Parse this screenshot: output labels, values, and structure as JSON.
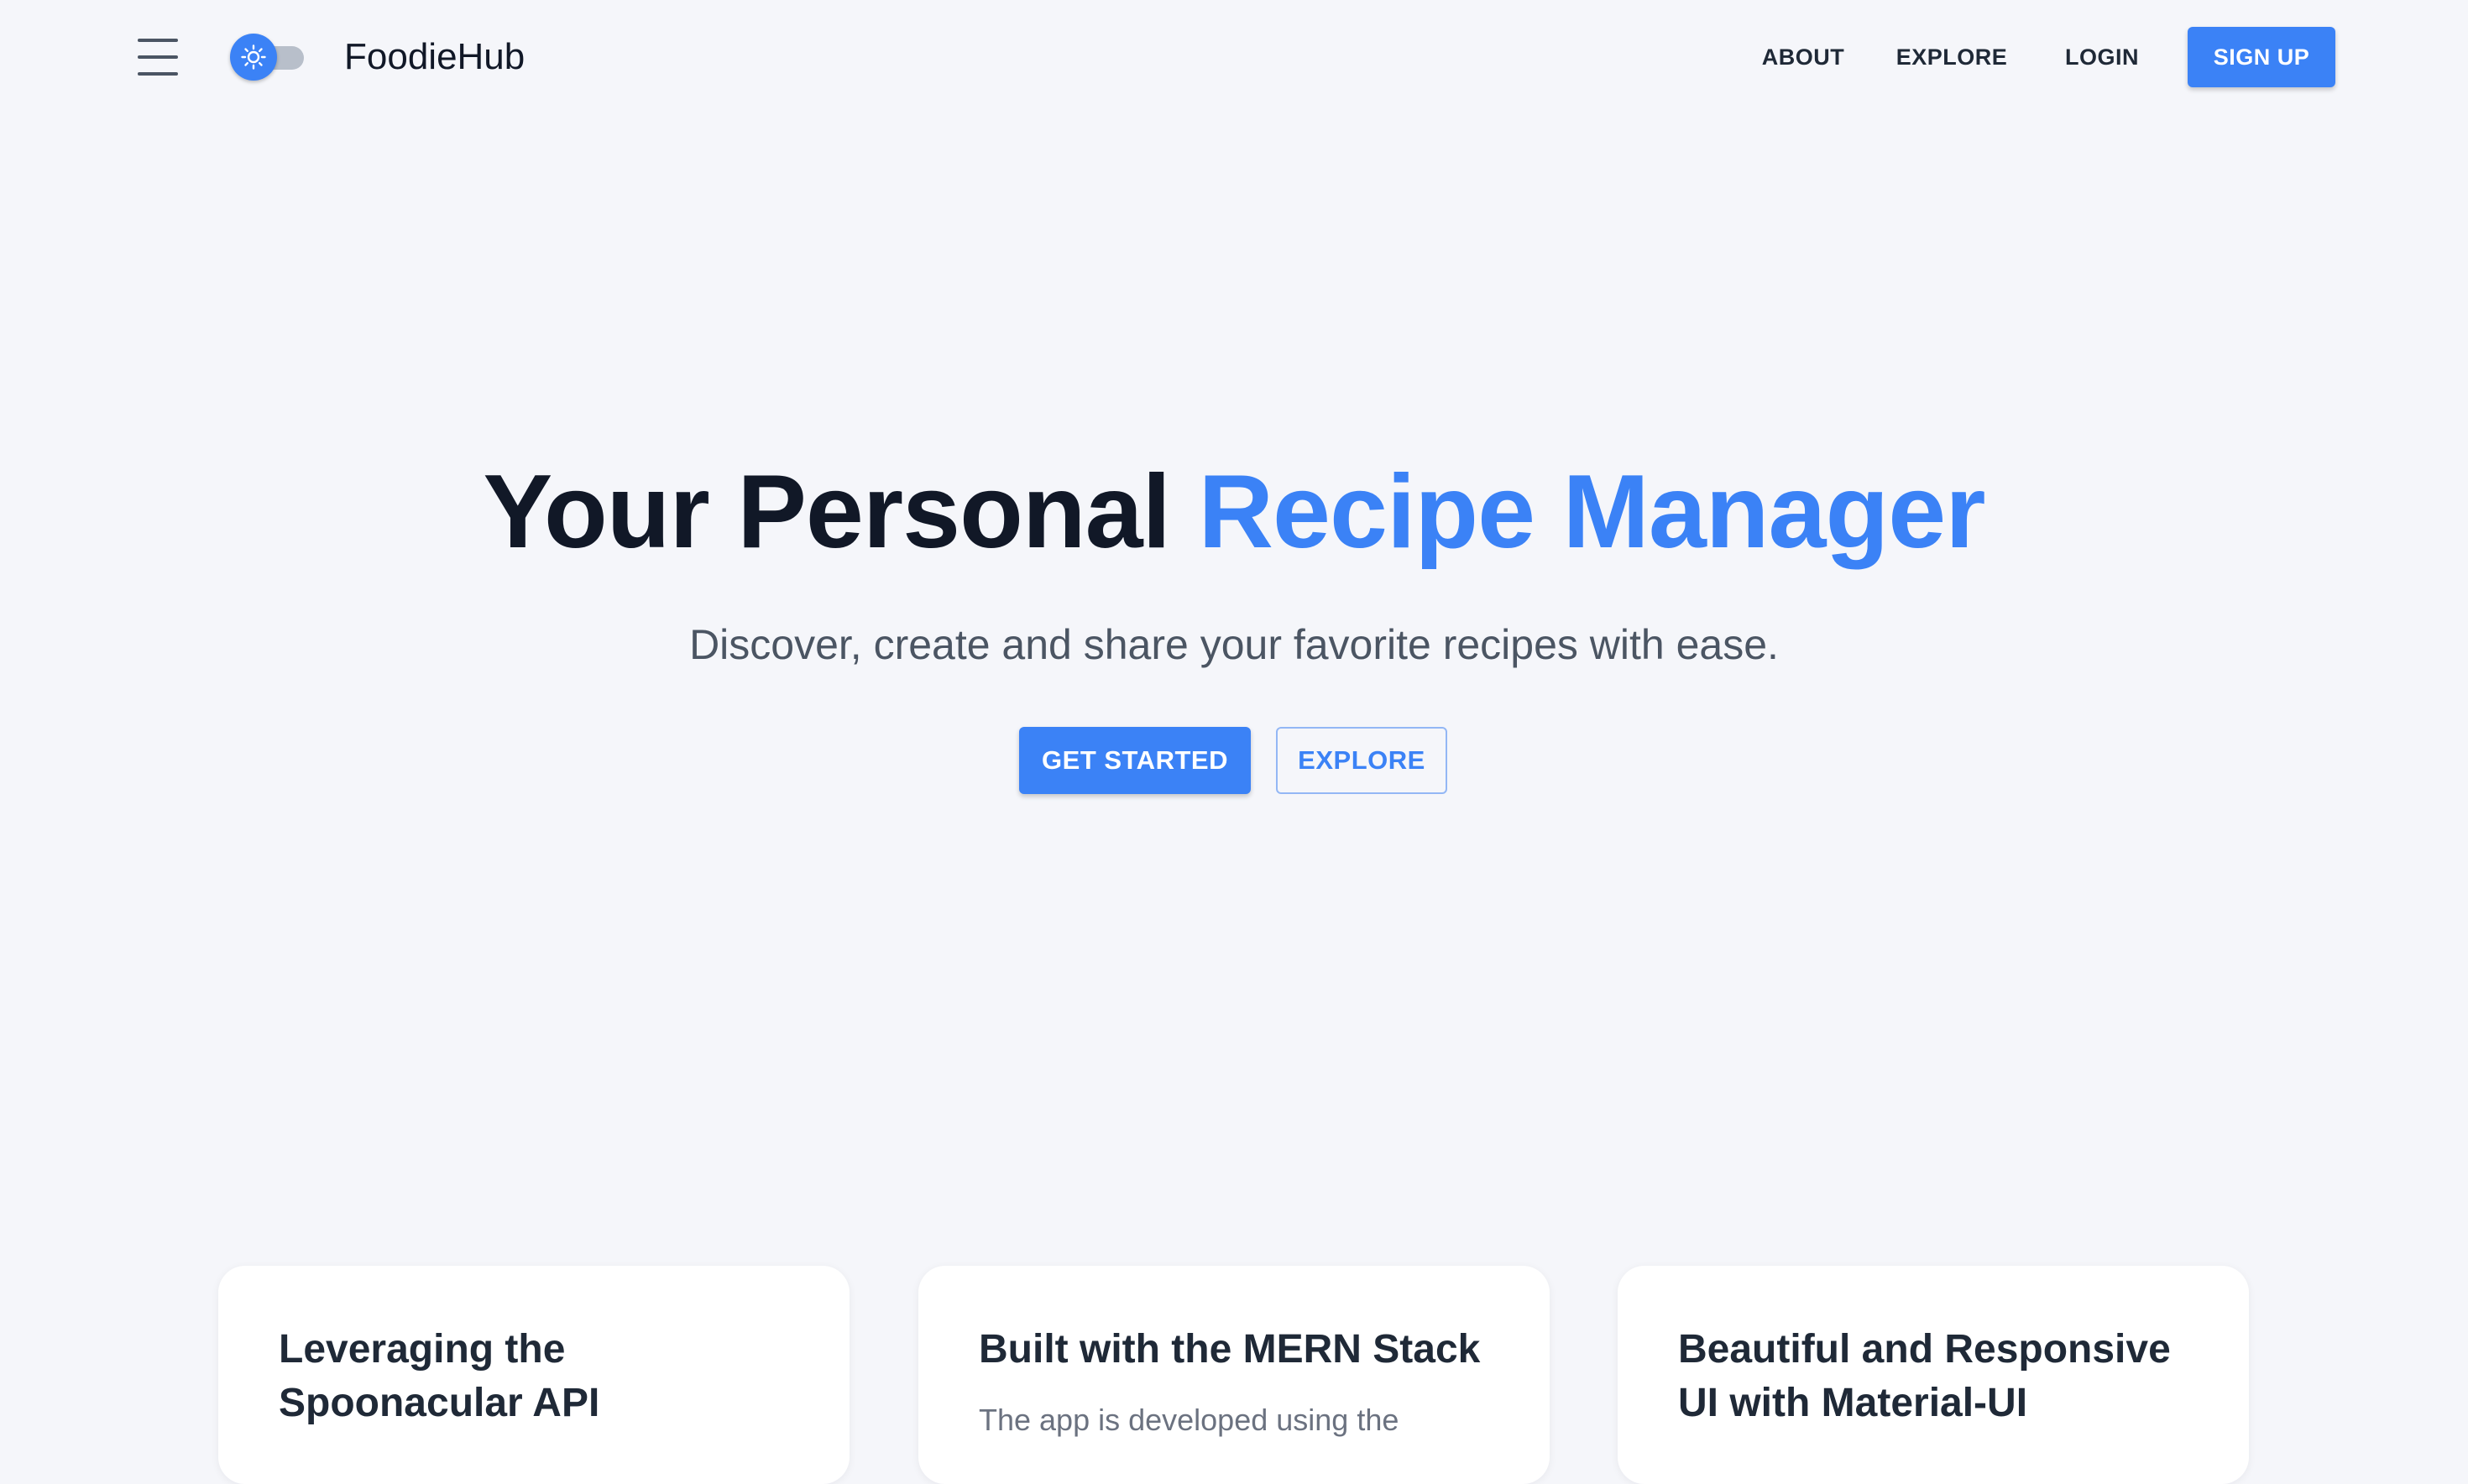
{
  "header": {
    "brand": "FoodieHub",
    "nav": {
      "about": "ABOUT",
      "explore": "EXPLORE",
      "login": "LOGIN",
      "signup": "SIGN UP"
    },
    "icons": {
      "menu": "menu-icon",
      "theme": "sun-icon"
    },
    "theme_toggle_on": false
  },
  "hero": {
    "title_part1": "Your Personal ",
    "title_part2": "Recipe Manager",
    "subtitle": "Discover, create and share your favorite recipes with ease.",
    "primary_cta": "GET STARTED",
    "secondary_cta": "EXPLORE"
  },
  "features": [
    {
      "title_line1": "Leveraging the",
      "title_line2": "Spoonacular API",
      "description": ""
    },
    {
      "title_line1": "Built with the MERN Stack",
      "title_line2": "",
      "description": "The app is developed using the"
    },
    {
      "title_line1": "Beautiful and Responsive",
      "title_line2": "UI with Material-UI",
      "description": ""
    }
  ],
  "colors": {
    "accent": "#3b82f6",
    "background": "#f5f6fa",
    "heading": "#111827",
    "muted_text": "#4b5563",
    "card": "#ffffff"
  }
}
